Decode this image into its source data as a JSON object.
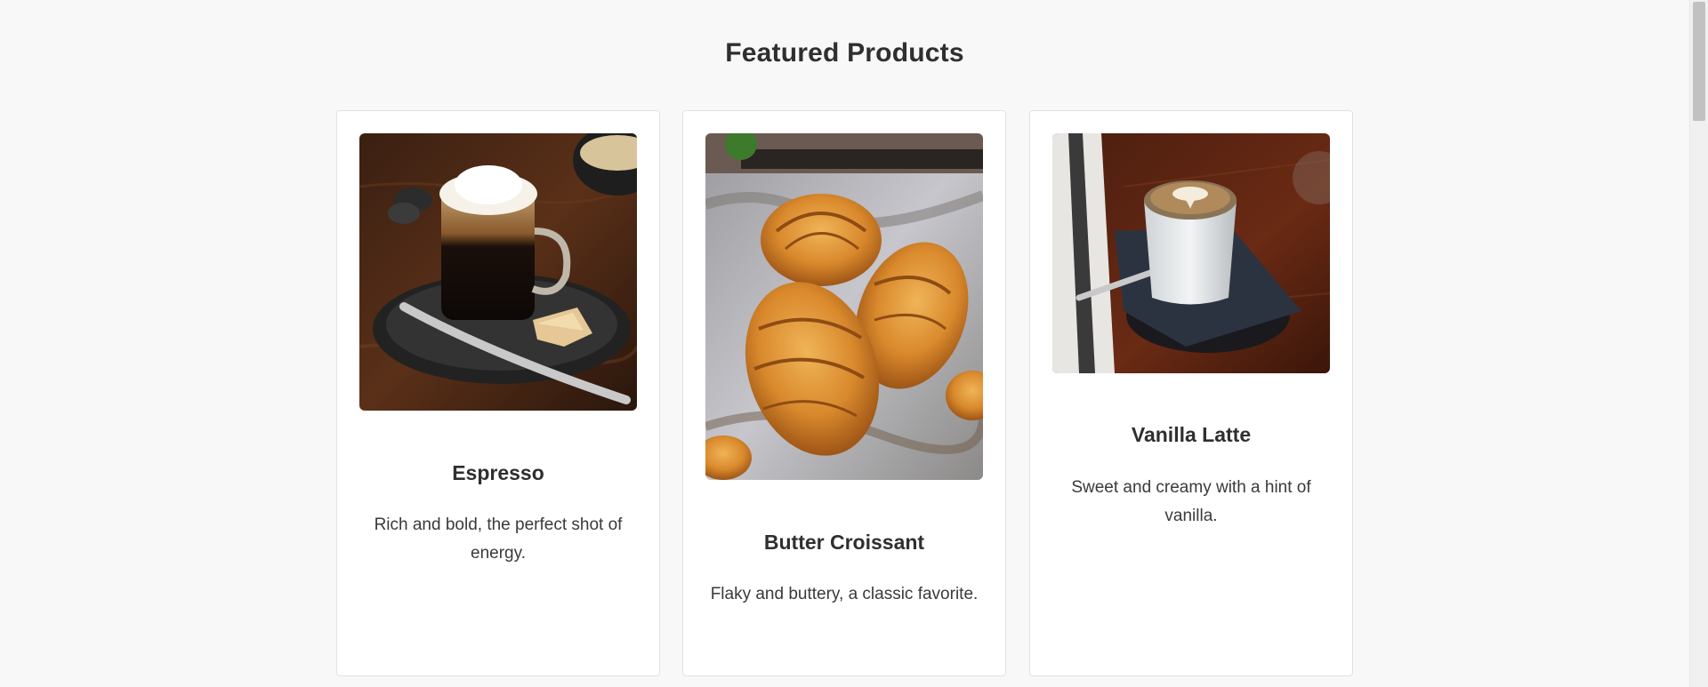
{
  "section": {
    "title": "Featured Products"
  },
  "products": [
    {
      "name": "Espresso",
      "description": "Rich and bold, the perfect shot of energy.",
      "image_icon": "espresso-photo"
    },
    {
      "name": "Butter Croissant",
      "description": "Flaky and buttery, a classic favorite.",
      "image_icon": "croissant-photo"
    },
    {
      "name": "Vanilla Latte",
      "description": "Sweet and creamy with a hint of vanilla.",
      "image_icon": "latte-photo"
    }
  ],
  "colors": {
    "page_background": "#f8f8f8",
    "card_background": "#ffffff",
    "card_border": "#e1e1e1",
    "text": "#2f2f2f"
  }
}
